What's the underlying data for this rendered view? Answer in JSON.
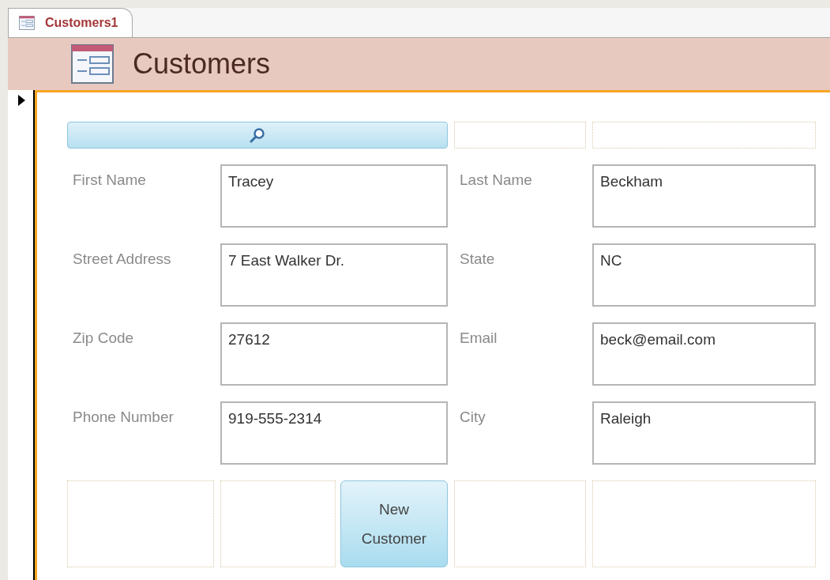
{
  "tabs": [
    {
      "label": "Customers1",
      "selected": true
    }
  ],
  "form_header": {
    "title": "Customers"
  },
  "fields": [
    {
      "label": "First Name",
      "value": "Tracey"
    },
    {
      "label": "Last Name",
      "value": "Beckham"
    },
    {
      "label": "Street Address",
      "value": "7 East Walker Dr."
    },
    {
      "label": "State",
      "value": "NC"
    },
    {
      "label": "Zip Code",
      "value": "27612"
    },
    {
      "label": "Email",
      "value": "beck@email.com"
    },
    {
      "label": "Phone Number",
      "value": "919-555-2314"
    },
    {
      "label": "City",
      "value": "Raleigh"
    }
  ],
  "buttons": [
    {
      "label": "New Customer"
    }
  ]
}
